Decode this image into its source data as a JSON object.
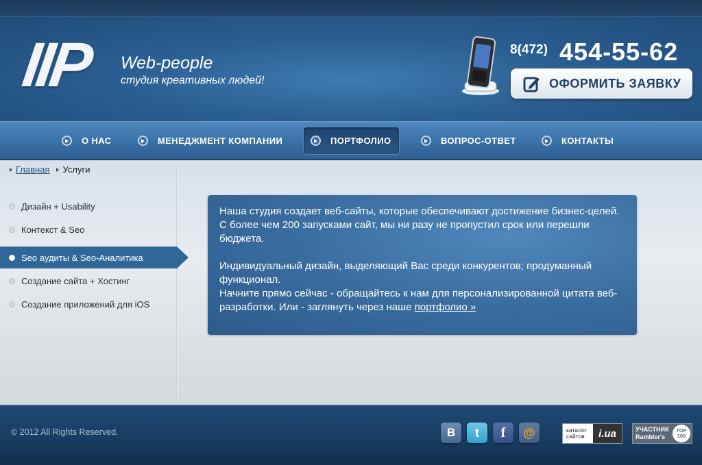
{
  "header": {
    "logo_mark": "IIP",
    "brand_name": "Web-people",
    "tagline": "студия креативных людей!",
    "phone_prefix": "8(472)",
    "phone_number": "454-55-62",
    "cta_label": "ОФОРМИТЬ ЗАЯВКУ",
    "cta_icon": "pencil-note-icon"
  },
  "nav": {
    "items": [
      {
        "label": "О НАС",
        "active": false
      },
      {
        "label": "МЕНЕДЖМЕНТ КОМПАНИИ",
        "active": false
      },
      {
        "label": "ПОРТФОЛИО",
        "active": true
      },
      {
        "label": "ВОПРОС-ОТВЕТ",
        "active": false
      },
      {
        "label": "КОНТАКТЫ",
        "active": false
      }
    ]
  },
  "breadcrumb": {
    "home": "Главная",
    "current": "Услуги"
  },
  "sidebar": {
    "items": [
      {
        "label": "Дизайн + Usability",
        "active": false
      },
      {
        "label": "Контекст & Seo",
        "active": false
      },
      {
        "label": "Seo аудиты & Seo-Аналитика",
        "active": true
      },
      {
        "label": "Создание сайта + Хостинг",
        "active": false
      },
      {
        "label": "Создание приложений для iOS",
        "active": false
      }
    ]
  },
  "content": {
    "paragraph1": "Наша студия создает веб-сайты, которые обеспечивают достижение бизнес-целей. С более чем 200 запусками сайт, мы ни разу не пропустил срок или перешли бюджета.",
    "paragraph2": "Индивидуальный дизайн, выделяющий Вас среди конкурентов; продуманный функционал.",
    "paragraph3": "Начните прямо сейчас - обращайтесь к нам для персонализированной цитата веб-разработки. Или - заглянуть через наше",
    "link": "портфолио »"
  },
  "footer": {
    "copyright": "© 2012  All Rights Reserved.",
    "social": [
      "vk-icon",
      "twitter-icon",
      "facebook-icon",
      "mail-icon"
    ],
    "badge_iua_label": "каталог сайтов",
    "badge_iua_mark": "i.ua",
    "badge_ramb_label": "УЧАСТНИК Rambler's",
    "badge_ramb_top": "TOP 100"
  },
  "colors": {
    "header_bg": "#2b5f92",
    "nav_bg": "#3b72a8",
    "active_item": "#2f6799",
    "footer_bg": "#173b60"
  }
}
